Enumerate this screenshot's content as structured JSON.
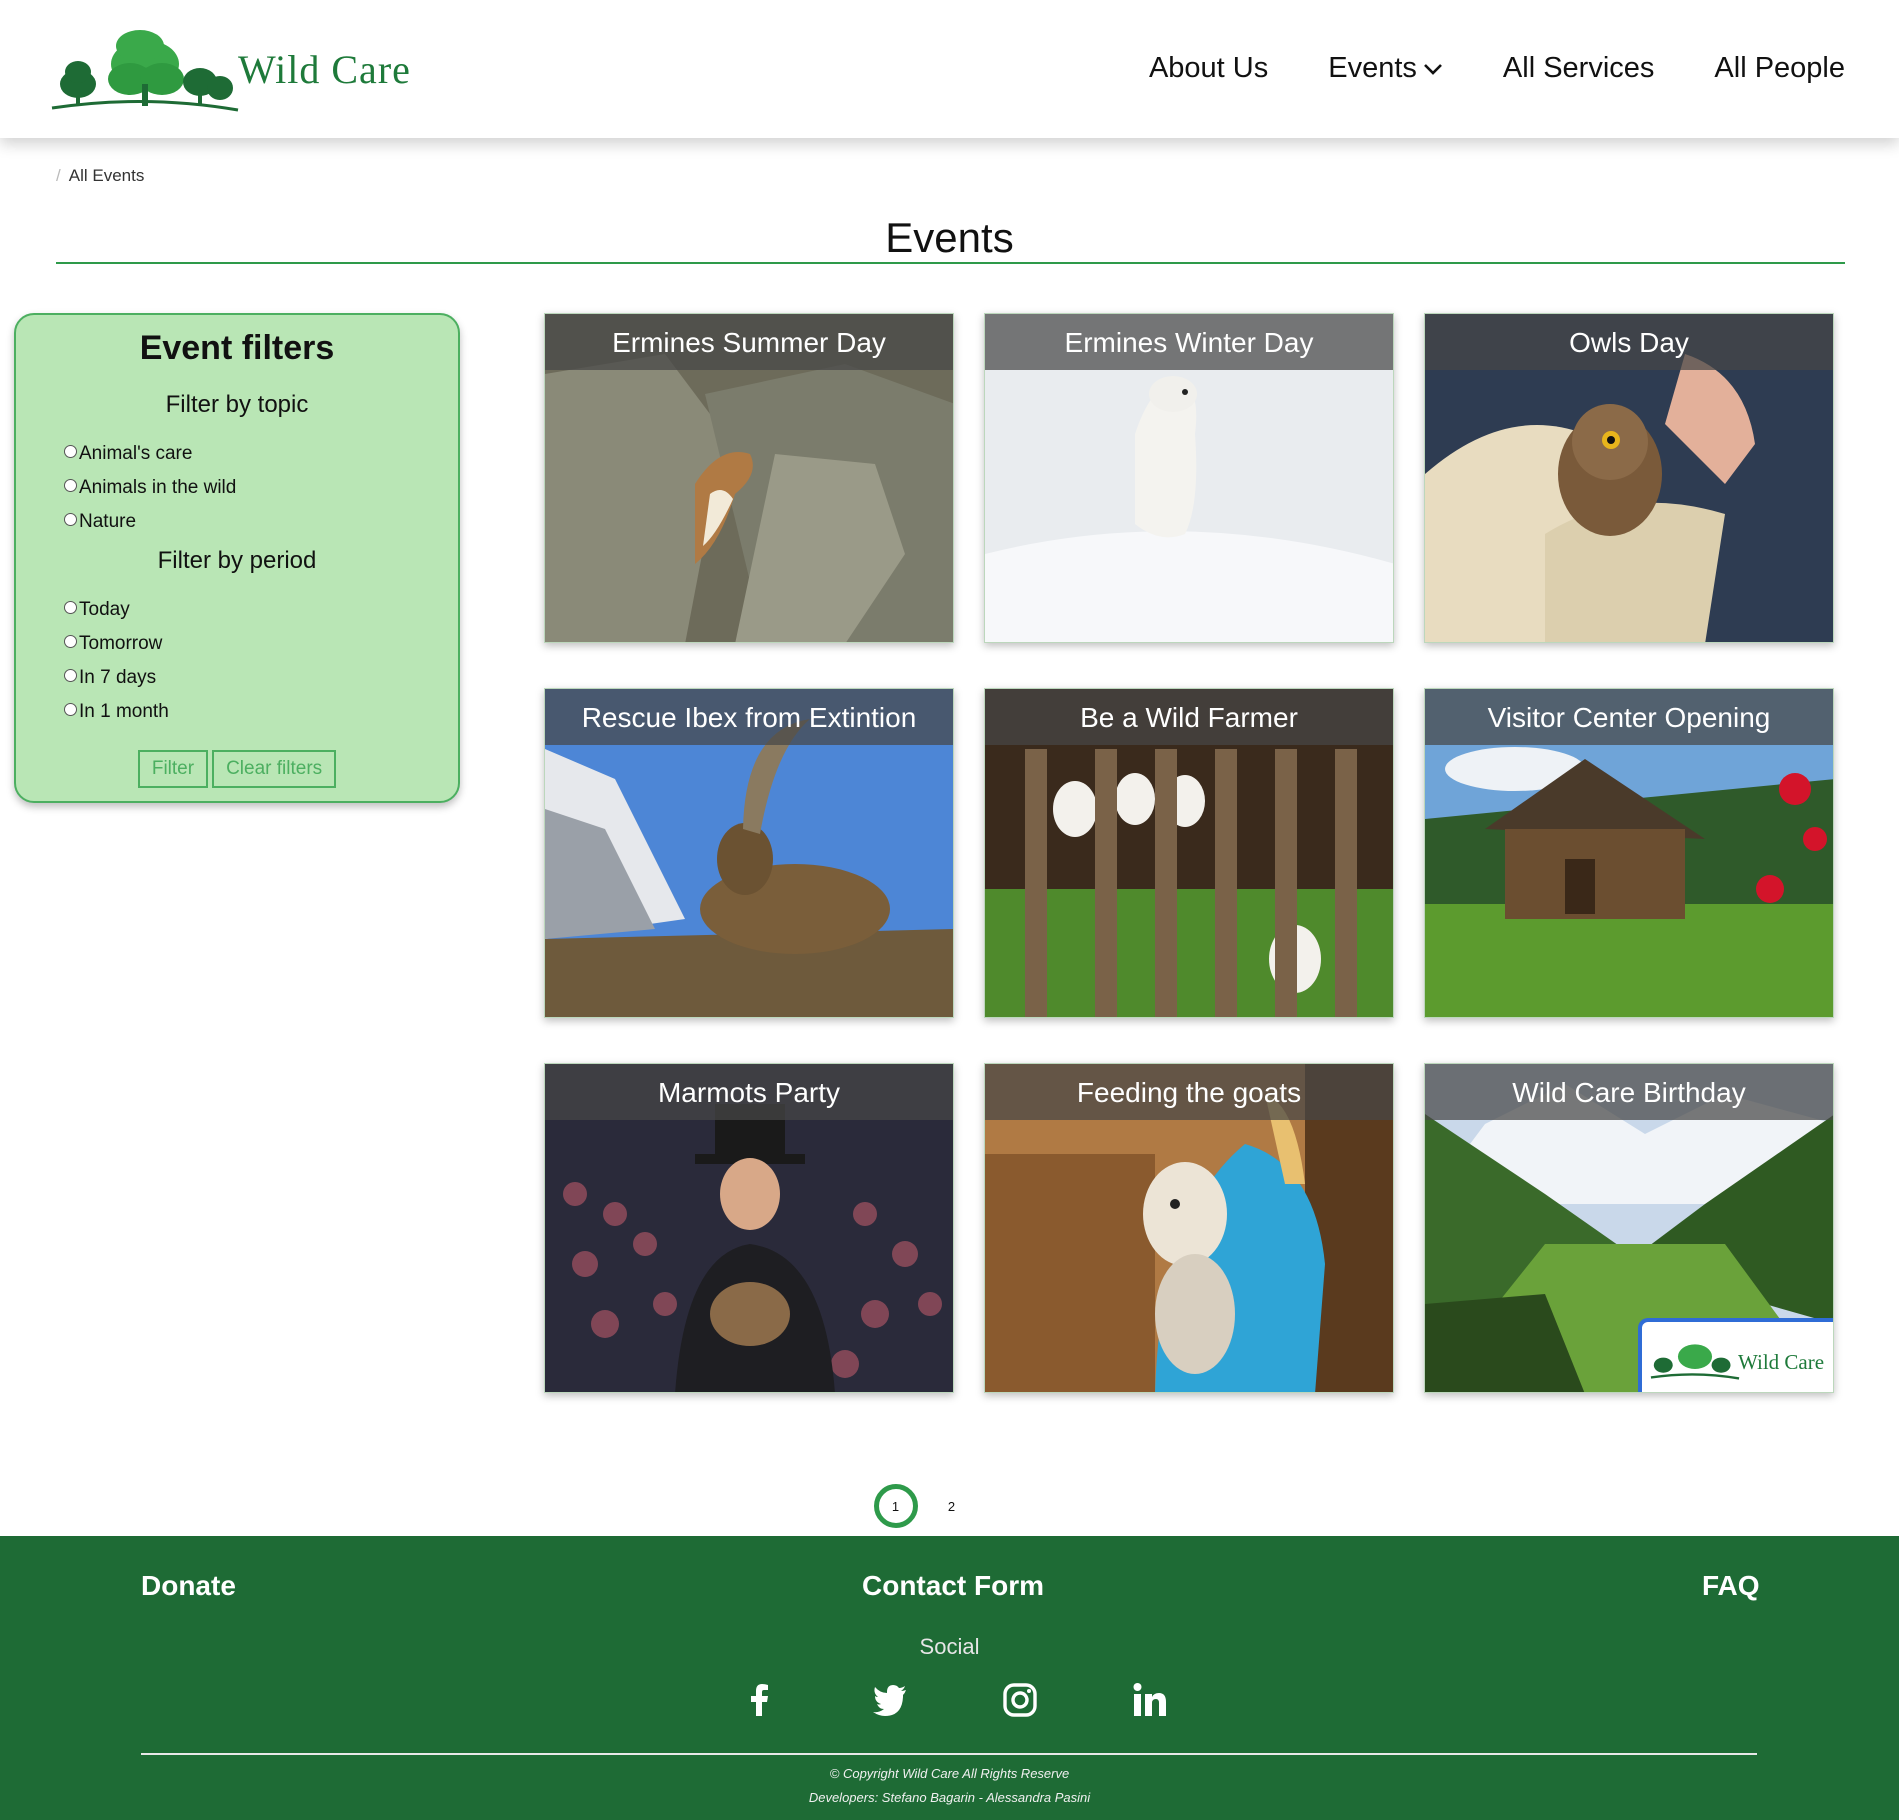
{
  "brand": {
    "name": "Wild Care"
  },
  "nav": {
    "items": [
      {
        "label": "About Us"
      },
      {
        "label": "Events",
        "has_dropdown": true
      },
      {
        "label": "All Services"
      },
      {
        "label": "All People"
      }
    ]
  },
  "breadcrumb": {
    "separator": "/",
    "current": "All Events"
  },
  "page_title": "Events",
  "filters": {
    "title": "Event filters",
    "topic": {
      "heading": "Filter by topic",
      "options": [
        "Animal's care",
        "Animals in the wild",
        "Nature"
      ]
    },
    "period": {
      "heading": "Filter by period",
      "options": [
        "Today",
        "Tomorrow",
        "In 7 days",
        "In 1 month"
      ]
    },
    "filter_button": "Filter",
    "clear_button": "Clear filters"
  },
  "events": [
    {
      "title": "Ermines Summer Day",
      "image": "ermine-on-rocks"
    },
    {
      "title": "Ermines Winter Day",
      "image": "white-ermine-in-snow"
    },
    {
      "title": "Owls Day",
      "image": "owl-in-hand"
    },
    {
      "title": "Rescue Ibex from Extintion",
      "image": "ibex-mountains"
    },
    {
      "title": "Be a Wild Farmer",
      "image": "goats-behind-fence"
    },
    {
      "title": "Visitor Center Opening",
      "image": "wooden-cabin"
    },
    {
      "title": "Marmots Party",
      "image": "man-holding-marmot-crowd"
    },
    {
      "title": "Feeding the goats",
      "image": "girl-holding-goat"
    },
    {
      "title": "Wild Care Birthday",
      "image": "alpine-valley",
      "badge": "Wild Care"
    }
  ],
  "pagination": {
    "pages": [
      "1",
      "2"
    ],
    "current": "1"
  },
  "footer": {
    "links": {
      "donate": "Donate",
      "contact": "Contact Form",
      "faq": "FAQ"
    },
    "social_label": "Social",
    "social_icons": [
      "facebook-icon",
      "twitter-icon",
      "instagram-icon",
      "linkedin-icon"
    ],
    "copyright": "© Copyright Wild Care All Rights Reserve",
    "developers": "Developers: Stefano Bagarin - Alessandra Pasini"
  },
  "colors": {
    "brand_green": "#1e7a3a",
    "footer_green": "#1e6b35",
    "filter_panel": "#b9e6b5",
    "accent": "#2e9a4a"
  }
}
